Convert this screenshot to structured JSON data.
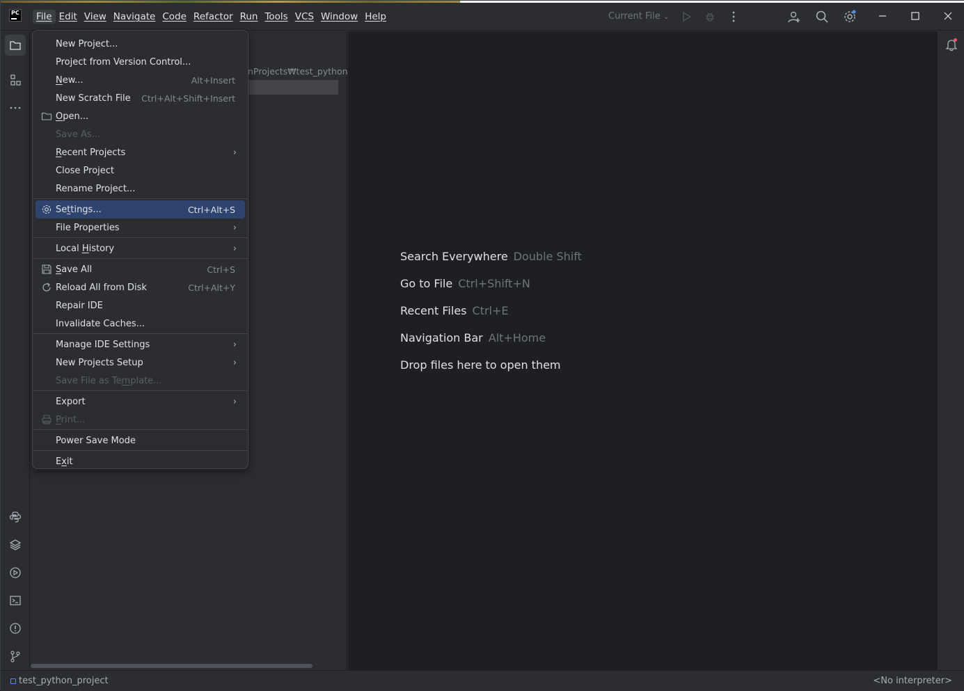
{
  "titlebar": {
    "menu": [
      "File",
      "Edit",
      "View",
      "Navigate",
      "Code",
      "Refactor",
      "Run",
      "Tools",
      "VCS",
      "Window",
      "Help"
    ],
    "run_config": "Current File"
  },
  "project_panel": {
    "path_fragment": "nProjects₩test_python_p"
  },
  "file_menu": [
    {
      "label": "New Project...",
      "shortcut": "",
      "submenu": false,
      "disabled": false,
      "icon": ""
    },
    {
      "label": "Project from Version Control...",
      "shortcut": "",
      "submenu": false,
      "disabled": false,
      "icon": ""
    },
    {
      "label": "New...",
      "shortcut": "Alt+Insert",
      "submenu": false,
      "disabled": false,
      "icon": ""
    },
    {
      "label": "New Scratch File",
      "shortcut": "Ctrl+Alt+Shift+Insert",
      "submenu": false,
      "disabled": false,
      "icon": ""
    },
    {
      "label": "Open...",
      "shortcut": "",
      "submenu": false,
      "disabled": false,
      "icon": "folder-icon"
    },
    {
      "label": "Save As...",
      "shortcut": "",
      "submenu": false,
      "disabled": true,
      "icon": ""
    },
    {
      "label": "Recent Projects",
      "shortcut": "",
      "submenu": true,
      "disabled": false,
      "icon": ""
    },
    {
      "label": "Close Project",
      "shortcut": "",
      "submenu": false,
      "disabled": false,
      "icon": ""
    },
    {
      "label": "Rename Project...",
      "shortcut": "",
      "submenu": false,
      "disabled": false,
      "icon": ""
    },
    {
      "separator": true
    },
    {
      "label": "Settings...",
      "shortcut": "Ctrl+Alt+S",
      "submenu": false,
      "disabled": false,
      "icon": "gear-icon",
      "selected": true
    },
    {
      "label": "File Properties",
      "shortcut": "",
      "submenu": true,
      "disabled": false,
      "icon": ""
    },
    {
      "separator": true
    },
    {
      "label": "Local History",
      "shortcut": "",
      "submenu": true,
      "disabled": false,
      "icon": ""
    },
    {
      "separator": true
    },
    {
      "label": "Save All",
      "shortcut": "Ctrl+S",
      "submenu": false,
      "disabled": false,
      "icon": "save-icon"
    },
    {
      "label": "Reload All from Disk",
      "shortcut": "Ctrl+Alt+Y",
      "submenu": false,
      "disabled": false,
      "icon": "reload-icon"
    },
    {
      "label": "Repair IDE",
      "shortcut": "",
      "submenu": false,
      "disabled": false,
      "icon": ""
    },
    {
      "label": "Invalidate Caches...",
      "shortcut": "",
      "submenu": false,
      "disabled": false,
      "icon": ""
    },
    {
      "separator": true
    },
    {
      "label": "Manage IDE Settings",
      "shortcut": "",
      "submenu": true,
      "disabled": false,
      "icon": ""
    },
    {
      "label": "New Projects Setup",
      "shortcut": "",
      "submenu": true,
      "disabled": false,
      "icon": ""
    },
    {
      "label": "Save File as Template...",
      "shortcut": "",
      "submenu": false,
      "disabled": true,
      "icon": ""
    },
    {
      "separator": true
    },
    {
      "label": "Export",
      "shortcut": "",
      "submenu": true,
      "disabled": false,
      "icon": ""
    },
    {
      "label": "Print...",
      "shortcut": "",
      "submenu": false,
      "disabled": true,
      "icon": "print-icon"
    },
    {
      "separator": true
    },
    {
      "label": "Power Save Mode",
      "shortcut": "",
      "submenu": false,
      "disabled": false,
      "icon": ""
    },
    {
      "separator": true
    },
    {
      "label": "Exit",
      "shortcut": "",
      "submenu": false,
      "disabled": false,
      "icon": ""
    }
  ],
  "editor_hints": [
    {
      "label": "Search Everywhere",
      "key": "Double Shift"
    },
    {
      "label": "Go to File",
      "key": "Ctrl+Shift+N"
    },
    {
      "label": "Recent Files",
      "key": "Ctrl+E"
    },
    {
      "label": "Navigation Bar",
      "key": "Alt+Home"
    },
    {
      "label": "Drop files here to open them",
      "key": ""
    }
  ],
  "statusbar": {
    "project": "test_python_project",
    "interpreter": "<No interpreter>"
  }
}
